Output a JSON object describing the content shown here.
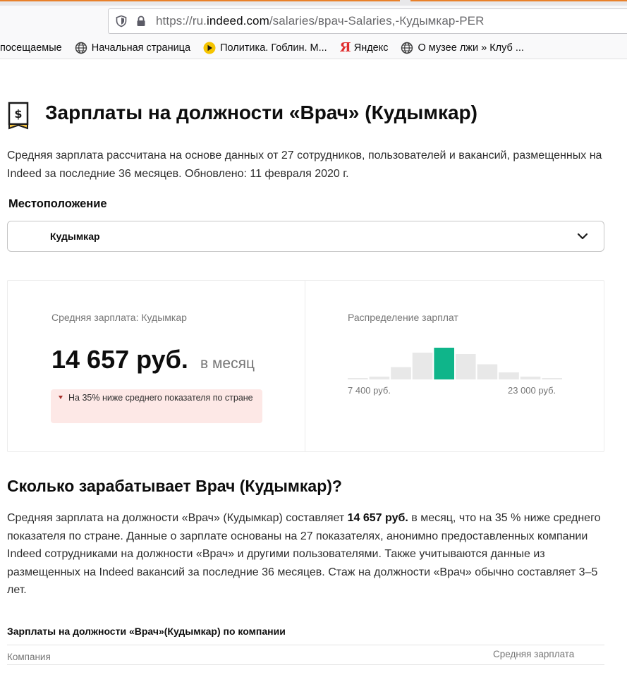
{
  "browser": {
    "url_prefix": "https://ru.",
    "url_domain": "indeed.com",
    "url_path": "/salaries/врач-Salaries,-Кудымкар-PER",
    "bookmarks": [
      {
        "label": "посещаемые",
        "icon": "none"
      },
      {
        "label": "Начальная страница",
        "icon": "globe-icon"
      },
      {
        "label": "Политика. Гоблин. М...",
        "icon": "play-icon"
      },
      {
        "label": "Яндекс",
        "icon": "yandex-icon"
      },
      {
        "label": "О музее лжи » Клуб ...",
        "icon": "globe-icon"
      }
    ],
    "yandex_glyph": "Я"
  },
  "page": {
    "title": "Зарплаты на должности «Врач» (Кудымкар)",
    "intro": "Средняя зарплата рассчитана на основе данных от 27 сотрудников, пользователей и вакансий, размещенных на Indeed за последние 36 месяцев. Обновлено: 11 февраля 2020 г.",
    "location_label": "Местоположение",
    "location_value": "Кудымкар"
  },
  "summary": {
    "avg_label": "Средняя зарплата: Кудымкар",
    "avg_value": "14 657 руб.",
    "avg_period": "в месяц",
    "compare_text": "На 35% ниже среднего показателя по стране",
    "dist_label": "Распределение зарплат",
    "min_label": "7 400 руб.",
    "max_label": "23 000 руб.",
    "highlight_color": "#0fb58a",
    "bar_color": "#e8e8e8"
  },
  "chart_data": {
    "type": "bar",
    "values": [
      0.04,
      0.08,
      0.35,
      0.76,
      0.9,
      0.72,
      0.43,
      0.2,
      0.08,
      0.04
    ],
    "highlight_index": 4,
    "xmin_label": "7 400 руб.",
    "xmax_label": "23 000 руб."
  },
  "details": {
    "heading": "Сколько зарабатывает Врач (Кудымкар)?",
    "p_before": "Средняя зарплата на должности «Врач» (Кудымкар) составляет ",
    "p_bold": "14 657 руб.",
    "p_after": " в месяц, что на 35 % ниже среднего показателя по стране. Данные о зарплате основаны на 27 показателях, анонимно предоставленных компании Indeed сотрудниками на должности «Врач» и другими пользователями. Также учитываются данные из размещенных на Indeed вакансий за последние 36 месяцев. Стаж на должности «Врач» обычно составляет 3–5 лет."
  },
  "by_company": {
    "heading": "Зарплаты на должности «Врач»(Кудымкар) по компании",
    "col_company": "Компания",
    "col_salary": "Средняя зарплата"
  }
}
